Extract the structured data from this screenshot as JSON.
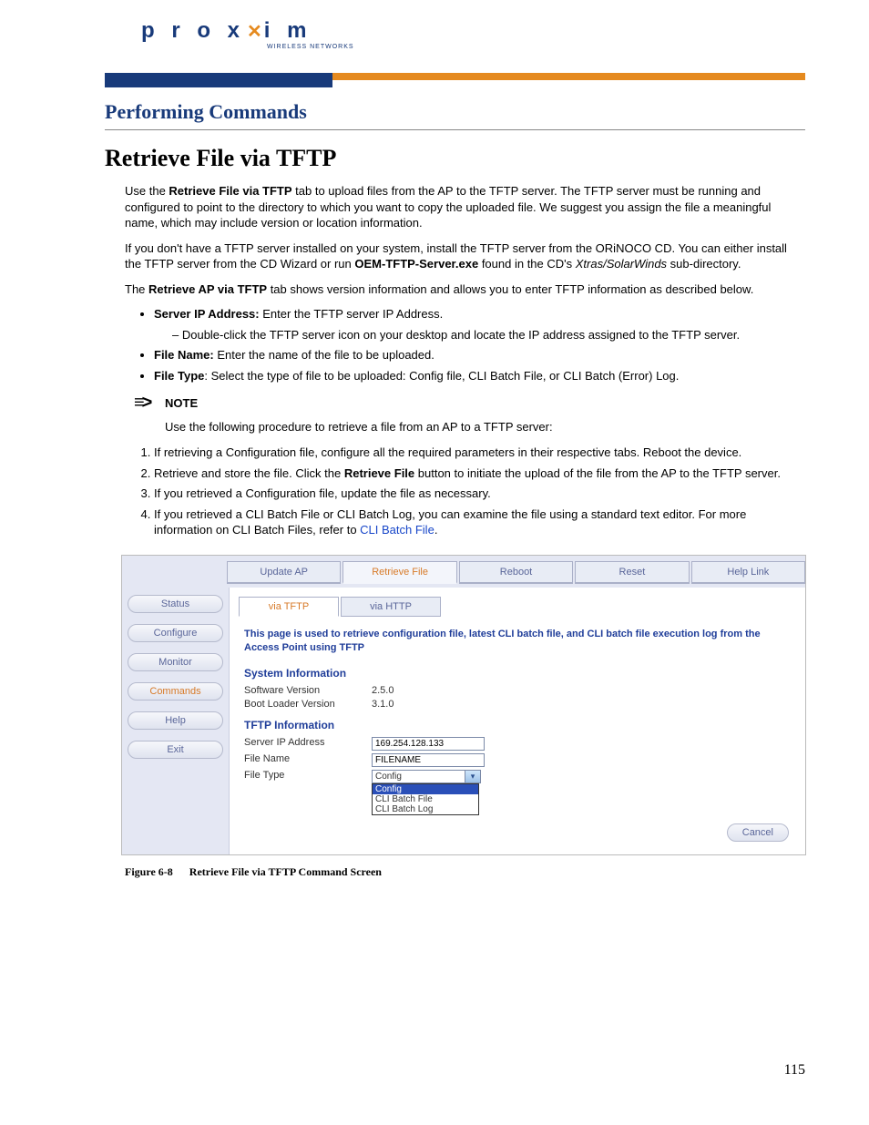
{
  "logo": {
    "brand": "p r o x",
    "brand2": "i m",
    "x": "✕",
    "sub": "WIRELESS NETWORKS"
  },
  "section_heading": "Performing Commands",
  "title": "Retrieve File via TFTP",
  "para1_pre": "Use the ",
  "para1_b": "Retrieve File via TFTP",
  "para1_post": " tab to upload files from the AP to the TFTP server. The TFTP server must be running and configured to point to the directory to which you want to copy the uploaded file. We suggest you assign the file a meaningful name, which may include version or location information.",
  "para2_pre": "If you don't have a TFTP server installed on your system, install the TFTP server from the ORiNOCO CD. You can either install the TFTP server from the CD Wizard or run ",
  "para2_b": "OEM-TFTP-Server.exe",
  "para2_mid": " found in the CD's ",
  "para2_i": "Xtras/SolarWinds",
  "para2_post": " sub-directory.",
  "para3_pre": "The ",
  "para3_b": "Retrieve AP via TFTP",
  "para3_post": " tab shows version information and allows you to enter TFTP information as described below.",
  "bullets": {
    "b1_b": "Server IP Address:",
    "b1_t": " Enter the TFTP server IP Address.",
    "b1_sub": "Double-click the TFTP server icon on your desktop and locate the IP address assigned to the TFTP server.",
    "b2_b": "File Name:",
    "b2_t": " Enter the name of the file to be uploaded.",
    "b3_b": "File Type",
    "b3_t": ": Select the type of file to be uploaded: Config file, CLI Batch File, or CLI Batch (Error) Log."
  },
  "note_label": "NOTE",
  "note_text": "Use the following procedure to retrieve a file from an AP to a TFTP server:",
  "steps": {
    "s1": "If retrieving a Configuration file, configure all the required parameters in their respective tabs. Reboot the device.",
    "s2_pre": "Retrieve and store the file. Click the ",
    "s2_b": "Retrieve File",
    "s2_post": " button to initiate the upload of the file from the AP to the TFTP server.",
    "s3": "If you retrieved a Configuration file, update the file as necessary.",
    "s4_pre": "If you retrieved a CLI Batch File or CLI Batch Log, you can examine the file using a standard text editor. For more information on CLI Batch Files, refer to ",
    "s4_link": "CLI Batch File",
    "s4_post": "."
  },
  "screenshot": {
    "top_tabs": [
      "Update AP",
      "Retrieve File",
      "Reboot",
      "Reset",
      "Help Link"
    ],
    "top_active": 1,
    "side_nav": [
      "Status",
      "Configure",
      "Monitor",
      "Commands",
      "Help",
      "Exit"
    ],
    "side_active": 3,
    "sub_tabs": [
      "via TFTP",
      "via HTTP"
    ],
    "sub_active": 0,
    "desc": "This page is used to retrieve configuration file, latest CLI batch file, and CLI batch file execution log from the Access Point using TFTP",
    "sys_heading": "System Information",
    "sys_rows": [
      {
        "label": "Software Version",
        "value": "2.5.0"
      },
      {
        "label": "Boot Loader Version",
        "value": "3.1.0"
      }
    ],
    "tftp_heading": "TFTP Information",
    "tftp_rows": {
      "ip_label": "Server IP Address",
      "ip_value": "169.254.128.133",
      "file_label": "File Name",
      "file_value": "FILENAME",
      "type_label": "File Type",
      "type_value": "Config"
    },
    "dropdown_opts": [
      "Config",
      "CLI Batch File",
      "CLI Batch Log"
    ],
    "cancel": "Cancel"
  },
  "figure": {
    "num": "Figure 6-8",
    "caption": "Retrieve File via TFTP Command Screen"
  },
  "page_number": "115"
}
